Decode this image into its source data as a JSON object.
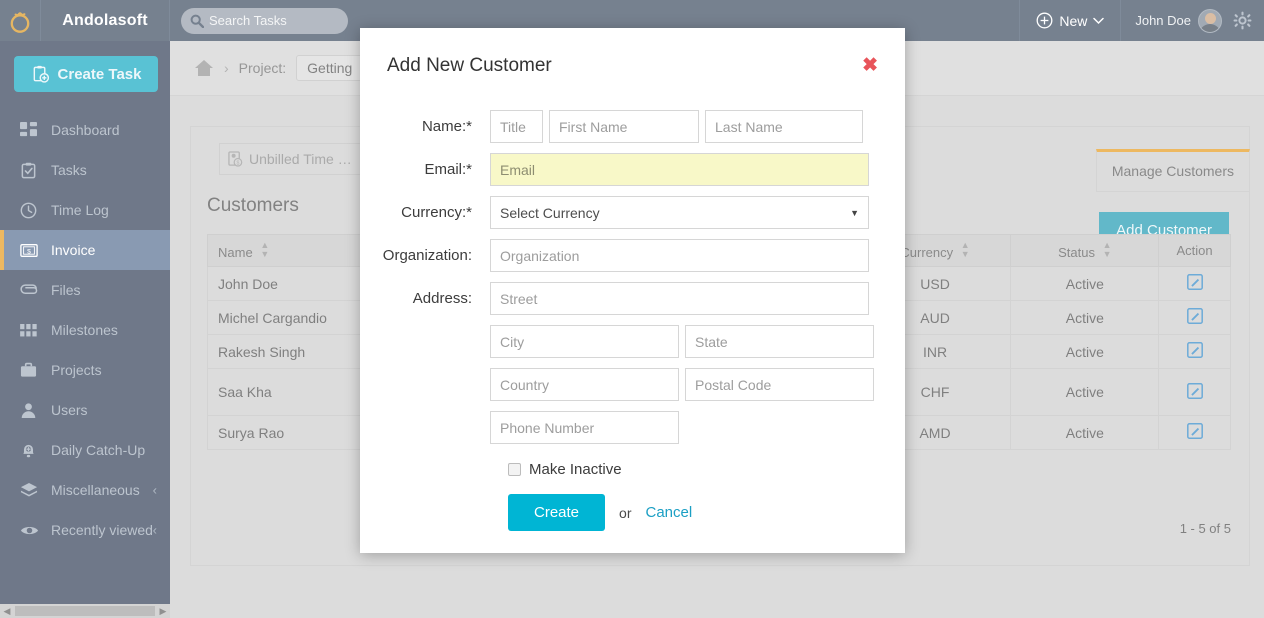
{
  "app": {
    "brand": "Andolasoft",
    "logo_icon": "ring-logo-icon",
    "logo_color": "#d9900f"
  },
  "topbar": {
    "search": {
      "placeholder": "Search Tasks",
      "value": "",
      "icon": "search-icon"
    },
    "new_button": {
      "label": "New",
      "plus_icon": "plus-circle-icon",
      "caret_icon": "chevron-down-icon"
    },
    "user": {
      "name": "John Doe",
      "avatar_icon": "user-avatar"
    },
    "settings_icon": "gear-icon"
  },
  "sidebar": {
    "create_task": {
      "label": "Create Task",
      "icon": "clipboard-plus-icon",
      "color": "#00a2bd"
    },
    "active_item": "Invoice",
    "active_accent": "#e3930c",
    "items": [
      {
        "label": "Dashboard",
        "icon": "dashboard-grid-icon",
        "active": false,
        "expandable": false
      },
      {
        "label": "Tasks",
        "icon": "clipboard-check-icon",
        "active": false,
        "expandable": false
      },
      {
        "label": "Time Log",
        "icon": "clock-icon",
        "active": false,
        "expandable": false
      },
      {
        "label": "Invoice",
        "icon": "invoice-dollar-icon",
        "active": true,
        "expandable": false
      },
      {
        "label": "Files",
        "icon": "paperclip-icon",
        "active": false,
        "expandable": false
      },
      {
        "label": "Milestones",
        "icon": "grid-squares-icon",
        "active": false,
        "expandable": false
      },
      {
        "label": "Projects",
        "icon": "briefcase-icon",
        "active": false,
        "expandable": false
      },
      {
        "label": "Users",
        "icon": "person-icon",
        "active": false,
        "expandable": false
      },
      {
        "label": "Daily Catch-Up",
        "icon": "bell-plus-icon",
        "active": false,
        "expandable": false
      },
      {
        "label": "Miscellaneous",
        "icon": "layers-icon",
        "active": false,
        "expandable": true,
        "chevron": "‹"
      },
      {
        "label": "Recently viewed",
        "icon": "eye-icon",
        "active": false,
        "expandable": true,
        "chevron": "‹"
      }
    ],
    "scrollbar": {
      "left_arrow": "◀",
      "right_arrow": "▶"
    }
  },
  "breadcrumb": {
    "home_icon": "home-icon",
    "separator": "›",
    "label": "Project:",
    "project_chip": "Getting"
  },
  "panel": {
    "unbilled_chip": {
      "label": "Unbilled Time  …",
      "icon": "money-report-icon"
    },
    "tab": {
      "label": "Manage Customers",
      "accent": "#e3930c"
    },
    "add_customer_button": {
      "label": "Add Customer",
      "color": "#0f93ac"
    },
    "table_title": "Customers",
    "pagination": "1 - 5 of 5"
  },
  "table": {
    "columns": [
      {
        "label": "Name",
        "sortable": true,
        "align": "left"
      },
      {
        "label": "",
        "sortable": false,
        "align": "left"
      },
      {
        "label": "Currency",
        "sortable": true,
        "align": "center"
      },
      {
        "label": "Status",
        "sortable": true,
        "align": "center"
      },
      {
        "label": "Action",
        "sortable": false,
        "align": "center"
      }
    ],
    "rows": [
      {
        "name": "John Doe",
        "blank": "",
        "currency": "USD",
        "status": "Active",
        "action_icon": "edit-pencil-icon"
      },
      {
        "name": "Michel Cargandio",
        "blank": "",
        "currency": "AUD",
        "status": "Active",
        "action_icon": "edit-pencil-icon"
      },
      {
        "name": "Rakesh Singh",
        "blank": "",
        "currency": "INR",
        "status": "Active",
        "action_icon": "edit-pencil-icon"
      },
      {
        "name": "Saa Kha",
        "blank": "",
        "currency": "CHF",
        "status": "Active",
        "action_icon": "edit-pencil-icon"
      },
      {
        "name": "Surya Rao",
        "blank": "",
        "currency": "AMD",
        "status": "Active",
        "action_icon": "edit-pencil-icon"
      }
    ]
  },
  "modal": {
    "title": "Add New Customer",
    "close_icon": "close-x-icon",
    "close_color": "#e8545a",
    "labels": {
      "name": "Name:*",
      "email": "Email:*",
      "currency": "Currency:*",
      "organization": "Organization:",
      "address": "Address:"
    },
    "fields": {
      "title": {
        "placeholder": "Title",
        "value": ""
      },
      "first_name": {
        "placeholder": "First Name",
        "value": ""
      },
      "last_name": {
        "placeholder": "Last Name",
        "value": ""
      },
      "email": {
        "placeholder": "Email",
        "value": "",
        "highlight": "#f8f8c8"
      },
      "currency": {
        "selected": "Select Currency",
        "caret": "▼"
      },
      "organization": {
        "placeholder": "Organization",
        "value": ""
      },
      "street": {
        "placeholder": "Street",
        "value": ""
      },
      "city": {
        "placeholder": "City",
        "value": ""
      },
      "state": {
        "placeholder": "State",
        "value": ""
      },
      "country": {
        "placeholder": "Country",
        "value": ""
      },
      "postal_code": {
        "placeholder": "Postal Code",
        "value": ""
      },
      "phone": {
        "placeholder": "Phone Number",
        "value": ""
      }
    },
    "make_inactive": {
      "label": "Make Inactive",
      "checked": false
    },
    "create_button": {
      "label": "Create",
      "color": "#00b5d4"
    },
    "or_text": "or",
    "cancel_link": {
      "label": "Cancel",
      "color": "#1b9fc4"
    }
  }
}
